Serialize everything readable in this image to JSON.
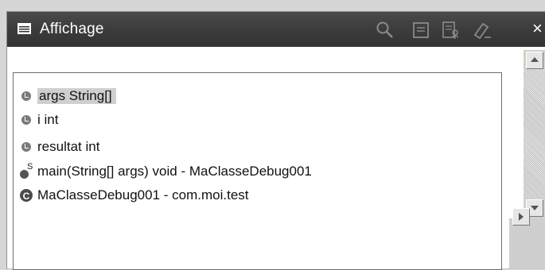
{
  "view": {
    "title": "Affichage",
    "toolbar_icons": [
      "search-icon",
      "document-icon",
      "inspect-icon",
      "clear-icon"
    ],
    "close_label": "×"
  },
  "popup": {
    "items": [
      {
        "text": "args   String[]",
        "icon": "field-icon",
        "selected": true
      },
      {
        "text": "i   int",
        "icon": "field-icon",
        "selected": false
      },
      {
        "text": "resultat   int",
        "icon": "field-icon",
        "selected": false
      },
      {
        "text": "main(String[] args)  void - MaClasseDebug001",
        "icon": "static-method-icon",
        "selected": false
      },
      {
        "text": "MaClasseDebug001 - com.moi.test",
        "icon": "class-icon",
        "selected": false
      }
    ],
    "class_icon_letter": "C",
    "static_marker": "S"
  }
}
